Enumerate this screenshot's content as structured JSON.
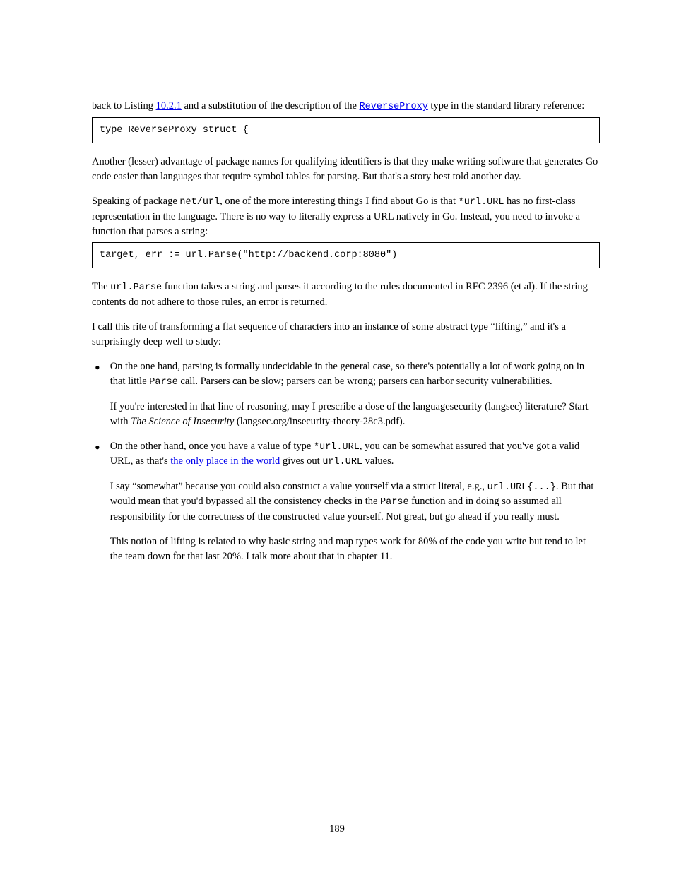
{
  "p1_a": "back to Listing ",
  "p1_link": "10.2.1",
  "p1_b": " and a substitution of the description of the ",
  "p1_link2": "ReverseProxy",
  "p1_c": " type in the standard library reference:",
  "box1": "type ReverseProxy struct {",
  "p2": "Another (lesser) advantage of package names for qualifying identifiers is that they make writing software that generates Go code easier than languages that require symbol tables for parsing. But that's a story best told another day.",
  "p3_a": "Speaking of package ",
  "p3_b": ", one of the more interesting things I find about Go is that ",
  "p3_c": " has no first-class representation in the language. There is no way to literally express a URL natively in Go. Instead, you need to invoke a function that parses a string:",
  "p3_mono1": "net/url",
  "p3_mono2": "*url.URL",
  "box2": "target, err := url.Parse(\"http://backend.corp:8080\")",
  "p4_a": "The ",
  "p4_b": " function takes a string and parses it according to the rules documented in RFC 2396 (et al). If the string contents do not adhere to those rules, an error is returned.",
  "p4_mono": "url.Parse",
  "p5": "I call this rite of transforming a flat sequence of characters into an instance of some abstract type “lifting,” and it's a surprisingly deep well to study:",
  "li1_p1_a": "On the one hand, parsing is formally undecidable in the general case, so there's potentially a lot of work going on in that little ",
  "li1_p1_b": " call. Parsers can be slow; parsers can be wrong; parsers can harbor security vulnerabilities.",
  "li1_mono": "Parse",
  "li1_p2_a": "If you're interested in that line of reasoning, may I prescribe a dose of the languagesecurity (langsec) literature? Start with ",
  "li1_p2_b": "Science of Insecurity",
  "li1_p2_c": "(langsec.org/insecurity-theory-28c3.pdf).",
  "li1_p2_em": "The ",
  "li2_p1_a": "On the other hand, once you have a value of type ",
  "li2_p1_b": ", you can be somewhat assured that you've got a valid URL, as that's ",
  "li2_p1_c": " gives out ",
  "li2_p1_d": " values.",
  "li2_mono1": "*url.URL",
  "li2_mono2": "url.URL",
  "li2_link": "the only place in the world",
  "li2_p2_a": "I say “somewhat” because you could also construct a value yourself via a struct literal, e.g., ",
  "li2_p2_b": ". But that would mean that you'd bypassed all the consistency checks in the ",
  "li2_p2_c": " function and in doing so assumed all responsibility for the correctness of the constructed value yourself. Not great, but go ahead if you really must.",
  "li2_mono3": "url.URL{...}",
  "li2_mono4": "Parse",
  "li2_p3": "This notion of lifting is related to why basic string and map types work for 80% of the code you write but tend to let the team down for that last 20%. I talk more about that in chapter 11.",
  "page": "189"
}
